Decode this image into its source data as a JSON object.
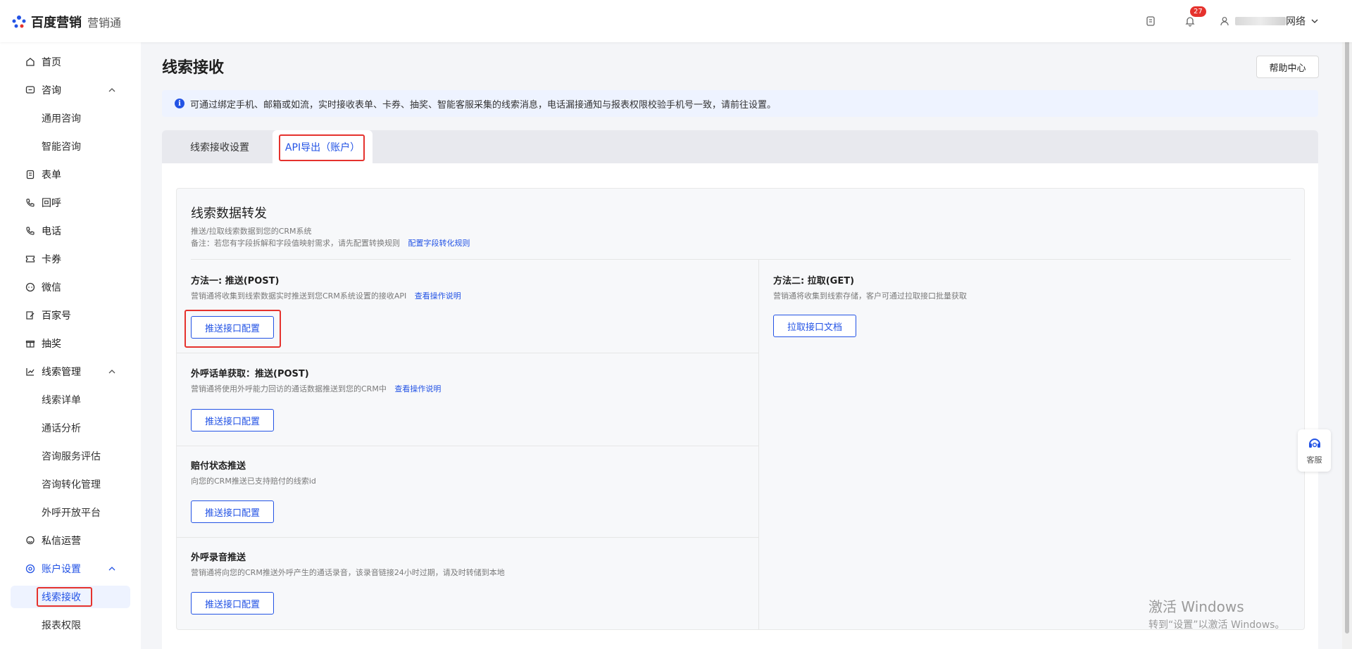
{
  "header": {
    "brand": "百度营销",
    "product": "营销通",
    "notification_count": "27",
    "user_suffix": "网络"
  },
  "sidebar": {
    "items": [
      {
        "label": "首页",
        "icon": "home-icon"
      },
      {
        "label": "咨询",
        "icon": "chat-icon"
      },
      {
        "label": "通用咨询"
      },
      {
        "label": "智能咨询"
      },
      {
        "label": "表单",
        "icon": "form-icon"
      },
      {
        "label": "回呼",
        "icon": "callback-icon"
      },
      {
        "label": "电话",
        "icon": "phone-icon"
      },
      {
        "label": "卡券",
        "icon": "coupon-icon"
      },
      {
        "label": "微信",
        "icon": "wechat-icon"
      },
      {
        "label": "百家号",
        "icon": "edit-icon"
      },
      {
        "label": "抽奖",
        "icon": "gift-icon"
      },
      {
        "label": "线索管理",
        "icon": "chart-icon"
      },
      {
        "label": "线索详单"
      },
      {
        "label": "通话分析"
      },
      {
        "label": "咨询服务评估"
      },
      {
        "label": "咨询转化管理"
      },
      {
        "label": "外呼开放平台"
      },
      {
        "label": "私信运营",
        "icon": "message-icon"
      },
      {
        "label": "账户设置",
        "icon": "settings-icon"
      },
      {
        "label": "线索接收"
      },
      {
        "label": "报表权限"
      }
    ]
  },
  "main": {
    "title": "线索接收",
    "help_label": "帮助中心",
    "notice": "可通过绑定手机、邮箱或如流，实时接收表单、卡券、抽奖、智能客服采集的线索消息，电话漏接通知与报表权限校验手机号一致，请前往设置。",
    "tabs": [
      {
        "label": "线索接收设置"
      },
      {
        "label": "API导出（账户）"
      }
    ],
    "card": {
      "title": "线索数据转发",
      "desc1": "推送/拉取线索数据到您的CRM系统",
      "desc2": "备注：若您有字段拆解和字段值映射需求，请先配置转换规则",
      "desc2_link": "配置字段转化规则"
    },
    "sections": [
      {
        "title": "方法一: 推送(POST)",
        "desc": "营销通将收集到线索数据实时推送到您CRM系统设置的接收API",
        "link": "查看操作说明",
        "button": "推送接口配置"
      },
      {
        "title": "外呼话单获取：推送(POST)",
        "desc": "营销通将使用外呼能力回访的通话数据推送到您的CRM中",
        "link": "查看操作说明",
        "button": "推送接口配置"
      },
      {
        "title": "赔付状态推送",
        "desc": "向您的CRM推送已支持赔付的线索id",
        "button": "推送接口配置"
      },
      {
        "title": "外呼录音推送",
        "desc": "营销通将向您的CRM推送外呼产生的通话录音，该录音链接24小时过期，请及时转储到本地",
        "button": "推送接口配置"
      }
    ],
    "method2": {
      "title": "方法二: 拉取(GET)",
      "desc": "营销通将收集到线索存储，客户可通过拉取接口批量获取",
      "button": "拉取接口文档"
    }
  },
  "service_label": "客服",
  "watermark": {
    "line1": "激活 Windows",
    "line2": "转到“设置”以激活 Windows。"
  }
}
